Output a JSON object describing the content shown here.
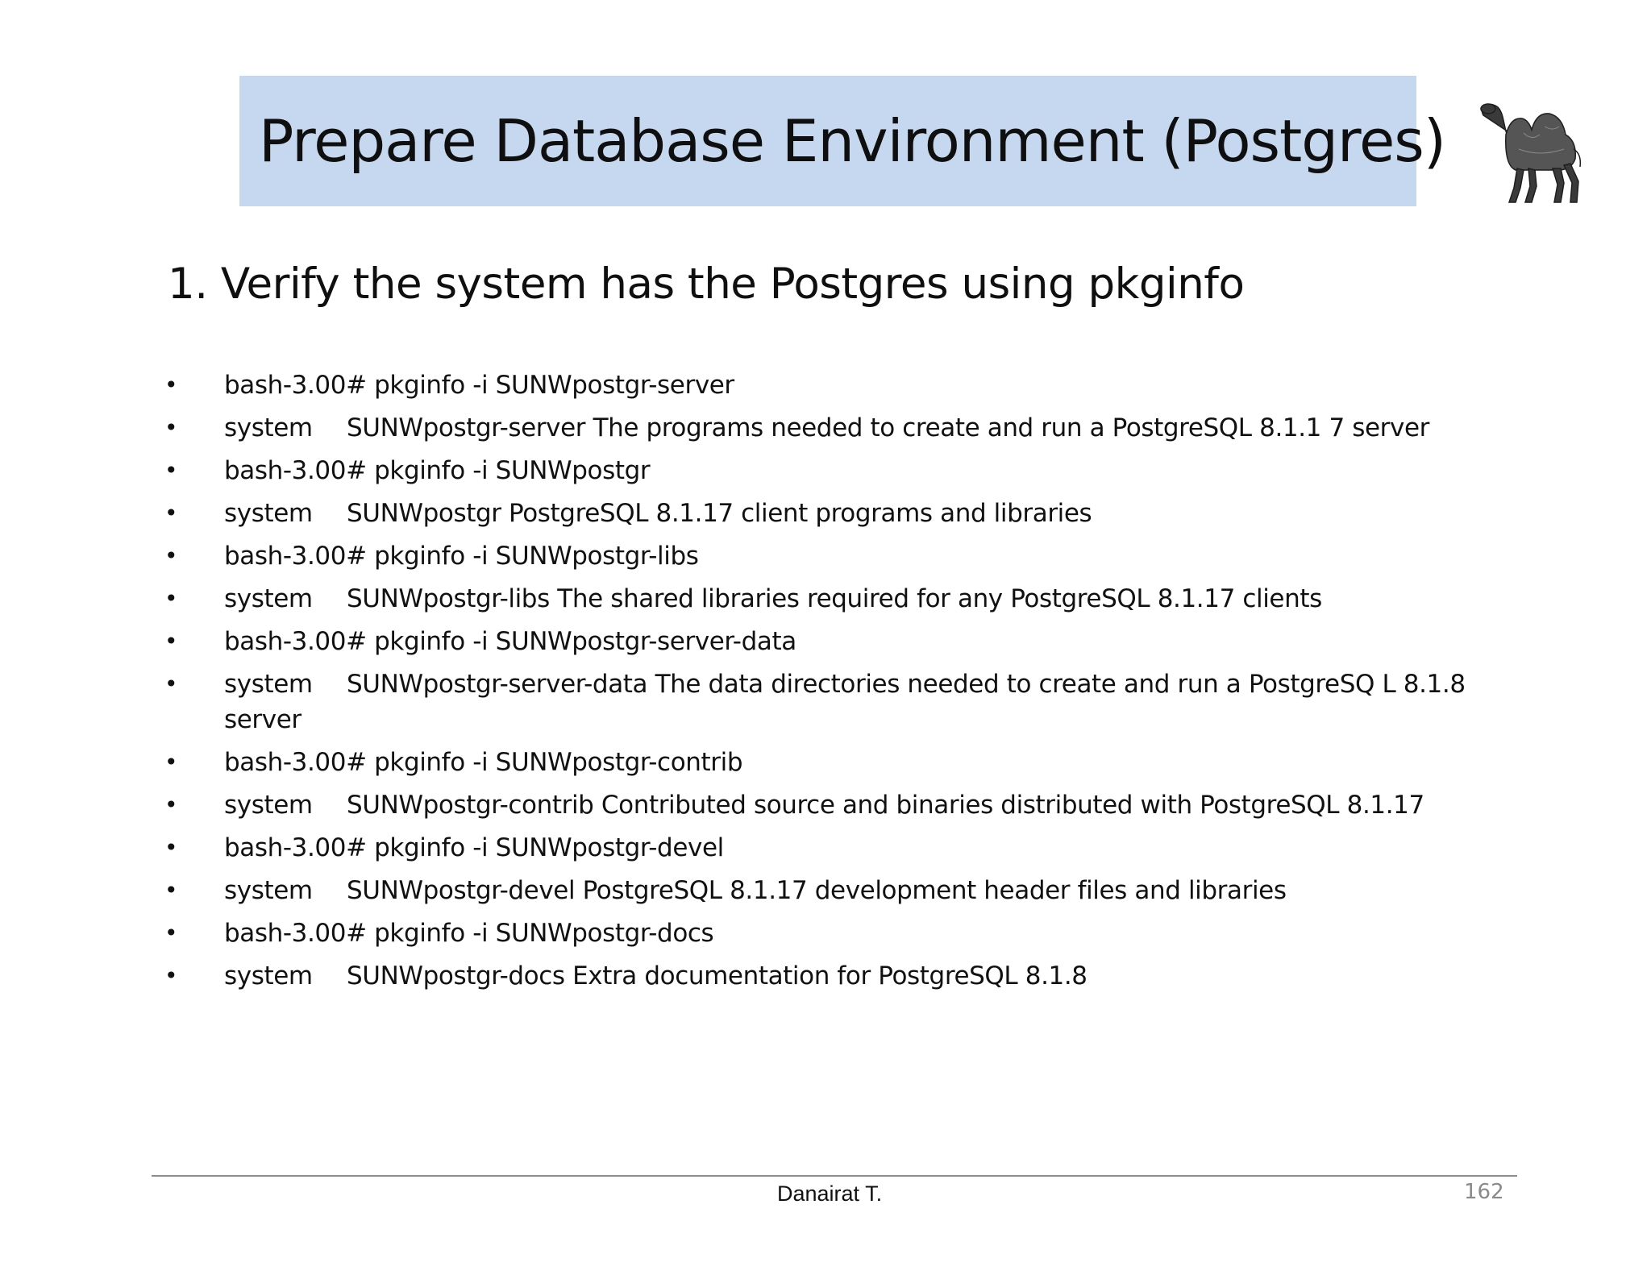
{
  "slide": {
    "title": "Prepare Database Environment (Postgres)",
    "subheading": "1. Verify the system has the Postgres using pkginfo",
    "bullet_symbol": "•",
    "items": [
      {
        "type": "cmd",
        "text": "bash-3.00# pkginfo -i SUNWpostgr-server"
      },
      {
        "type": "sys",
        "col1": "system",
        "text": "SUNWpostgr-server The programs needed to create and run a PostgreSQL 8.1.1 7 server"
      },
      {
        "type": "cmd",
        "text": "bash-3.00# pkginfo -i SUNWpostgr"
      },
      {
        "type": "sys",
        "col1": "system",
        "text": "SUNWpostgr PostgreSQL 8.1.17 client programs and libraries"
      },
      {
        "type": "cmd",
        "text": "bash-3.00# pkginfo -i SUNWpostgr-libs"
      },
      {
        "type": "sys",
        "col1": "system",
        "text": "SUNWpostgr-libs The shared libraries required for any PostgreSQL 8.1.17 clients"
      },
      {
        "type": "cmd",
        "text": "bash-3.00# pkginfo -i SUNWpostgr-server-data"
      },
      {
        "type": "sys",
        "col1": "system",
        "text": "SUNWpostgr-server-data The data directories needed to create and run a PostgreSQ L 8.1.8 server"
      },
      {
        "type": "cmd",
        "text": "bash-3.00# pkginfo -i SUNWpostgr-contrib"
      },
      {
        "type": "sys",
        "col1": "system",
        "text": "SUNWpostgr-contrib Contributed source and binaries distributed with PostgreSQL 8.1.17"
      },
      {
        "type": "cmd",
        "text": "bash-3.00# pkginfo -i SUNWpostgr-devel"
      },
      {
        "type": "sys",
        "col1": "system",
        "text": "SUNWpostgr-devel PostgreSQL 8.1.17 development header files and libraries"
      },
      {
        "type": "cmd",
        "text": "bash-3.00# pkginfo -i SUNWpostgr-docs"
      },
      {
        "type": "sys",
        "col1": "system",
        "text": "SUNWpostgr-docs Extra documentation for PostgreSQL 8.1.8"
      }
    ]
  },
  "footer": {
    "author": "Danairat T.",
    "page_number": "162"
  },
  "logo": {
    "icon": "camel-icon"
  },
  "colors": {
    "title_background": "#c6d8ef",
    "page_number": "#8a8a8a",
    "footer_rule": "#8c8c8c"
  }
}
